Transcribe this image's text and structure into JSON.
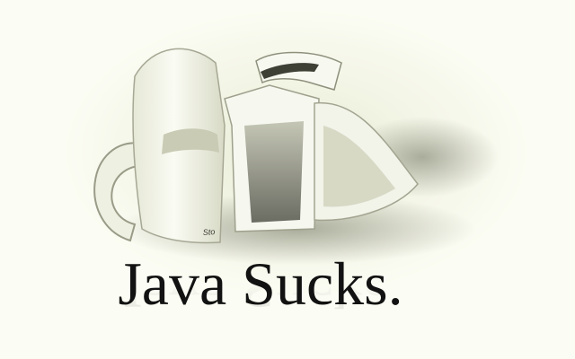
{
  "caption": {
    "text": "Java Sucks."
  },
  "mug": {
    "print_text": "Sto"
  },
  "colors": {
    "background": "#fbfcf3",
    "mug_white": "#f4f5ec",
    "mug_shadow": "#8c8f7c",
    "text": "#121212"
  }
}
